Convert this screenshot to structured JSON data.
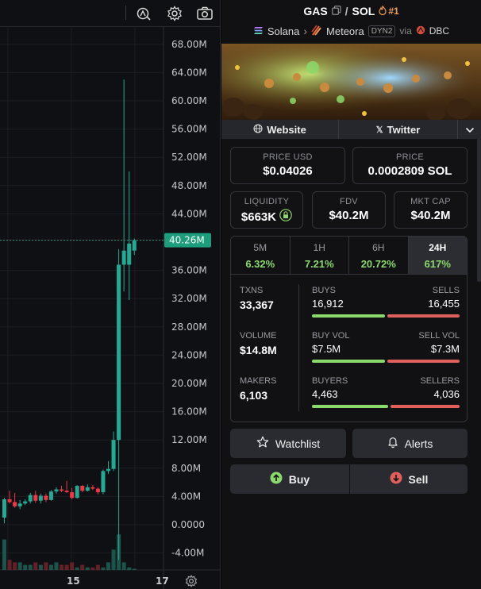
{
  "chart": {
    "y_ticks": [
      "68.00M",
      "64.00M",
      "60.00M",
      "56.00M",
      "52.00M",
      "48.00M",
      "44.00M",
      "40.26M",
      "36.00M",
      "32.00M",
      "28.00M",
      "24.00M",
      "20.00M",
      "16.00M",
      "12.00M",
      "8.00M",
      "4.00M",
      "0.0000",
      "-4.00M"
    ],
    "current_price_label": "40.26M",
    "x_ticks": [
      "15",
      "17"
    ],
    "colors": {
      "up": "#22ab94",
      "down": "#f23645",
      "price_tag": "#1c9e7c"
    }
  },
  "chart_data": {
    "type": "candlestick",
    "ylabel": "",
    "xlabel": "",
    "ylim": [
      -6,
      70
    ],
    "current_price": 40.26,
    "ohlc": [
      {
        "o": 1.0,
        "h": 3.8,
        "l": 0.2,
        "c": 3.6
      },
      {
        "o": 3.6,
        "h": 4.8,
        "l": 3.0,
        "c": 3.2
      },
      {
        "o": 3.2,
        "h": 4.5,
        "l": 2.4,
        "c": 2.6
      },
      {
        "o": 2.6,
        "h": 3.5,
        "l": 2.2,
        "c": 3.0
      },
      {
        "o": 3.0,
        "h": 3.6,
        "l": 2.8,
        "c": 3.3
      },
      {
        "o": 3.3,
        "h": 4.5,
        "l": 3.0,
        "c": 4.2
      },
      {
        "o": 4.2,
        "h": 4.8,
        "l": 3.1,
        "c": 3.4
      },
      {
        "o": 3.4,
        "h": 4.4,
        "l": 3.0,
        "c": 4.1
      },
      {
        "o": 4.1,
        "h": 4.4,
        "l": 3.2,
        "c": 3.5
      },
      {
        "o": 3.5,
        "h": 4.9,
        "l": 3.4,
        "c": 4.7
      },
      {
        "o": 4.7,
        "h": 5.3,
        "l": 4.4,
        "c": 5.0
      },
      {
        "o": 5.0,
        "h": 5.5,
        "l": 4.6,
        "c": 4.8
      },
      {
        "o": 4.8,
        "h": 6.2,
        "l": 4.5,
        "c": 4.6
      },
      {
        "o": 4.6,
        "h": 5.2,
        "l": 3.6,
        "c": 3.8
      },
      {
        "o": 3.8,
        "h": 5.6,
        "l": 3.7,
        "c": 5.5
      },
      {
        "o": 5.5,
        "h": 5.6,
        "l": 4.6,
        "c": 4.8
      },
      {
        "o": 4.8,
        "h": 5.7,
        "l": 4.7,
        "c": 5.3
      },
      {
        "o": 5.3,
        "h": 5.6,
        "l": 4.9,
        "c": 5.1
      },
      {
        "o": 5.1,
        "h": 5.3,
        "l": 4.3,
        "c": 4.6
      },
      {
        "o": 4.6,
        "h": 7.8,
        "l": 4.3,
        "c": 7.6
      },
      {
        "o": 7.6,
        "h": 9.0,
        "l": 7.2,
        "c": 7.9
      },
      {
        "o": 7.9,
        "h": 13.2,
        "l": 7.6,
        "c": 12.0
      },
      {
        "o": 12.0,
        "h": 39.0,
        "l": -5.0,
        "c": 36.8
      },
      {
        "o": 36.8,
        "h": 63.0,
        "l": 33.0,
        "c": 38.8
      },
      {
        "o": 36.8,
        "h": 50.0,
        "l": 31.8,
        "c": 39.8
      },
      {
        "o": 38.8,
        "h": 40.5,
        "l": 38.2,
        "c": 40.26
      }
    ],
    "volume": [
      12,
      4,
      3,
      3,
      2,
      2,
      3,
      2,
      3,
      2,
      3,
      2,
      2,
      3,
      1,
      2,
      1,
      1,
      2,
      1,
      3,
      8,
      14,
      3,
      1,
      0.5
    ]
  },
  "toolbar": {
    "icons": [
      "indicator-icon",
      "gear-icon",
      "camera-icon"
    ]
  },
  "token": {
    "symbol": "GAS",
    "quote": "SOL",
    "rank": "#1",
    "chain": "Solana",
    "dex": "Meteora",
    "pool_badge": "DYN2",
    "via": "via",
    "launchpad": "DBC"
  },
  "links": {
    "website": "Website",
    "twitter": "Twitter"
  },
  "price": {
    "usd_label": "PRICE USD",
    "usd_value": "$0.04026",
    "native_label": "PRICE",
    "native_value": "0.0002809 SOL"
  },
  "metrics": {
    "liquidity_label": "LIQUIDITY",
    "liquidity_value": "$663K",
    "fdv_label": "FDV",
    "fdv_value": "$40.2M",
    "mcap_label": "MKT CAP",
    "mcap_value": "$40.2M"
  },
  "timeframes": [
    {
      "label": "5M",
      "change": "6.32%"
    },
    {
      "label": "1H",
      "change": "7.21%"
    },
    {
      "label": "6H",
      "change": "20.72%"
    },
    {
      "label": "24H",
      "change": "617%"
    }
  ],
  "stats": {
    "txns_label": "TXNS",
    "txns_value": "33,367",
    "volume_label": "VOLUME",
    "volume_value": "$14.8M",
    "makers_label": "MAKERS",
    "makers_value": "6,103",
    "buys_label": "BUYS",
    "buys_value": "16,912",
    "sells_label": "SELLS",
    "sells_value": "16,455",
    "buyvol_label": "BUY VOL",
    "buyvol_value": "$7.5M",
    "sellvol_label": "SELL VOL",
    "sellvol_value": "$7.3M",
    "buyers_label": "BUYERS",
    "buyers_value": "4,463",
    "sellers_label": "SELLERS",
    "sellers_value": "4,036",
    "buy_ratio": 0.507,
    "buyvol_ratio": 0.507,
    "buyers_ratio": 0.525
  },
  "actions": {
    "watchlist": "Watchlist",
    "alerts": "Alerts",
    "buy": "Buy",
    "sell": "Sell"
  }
}
